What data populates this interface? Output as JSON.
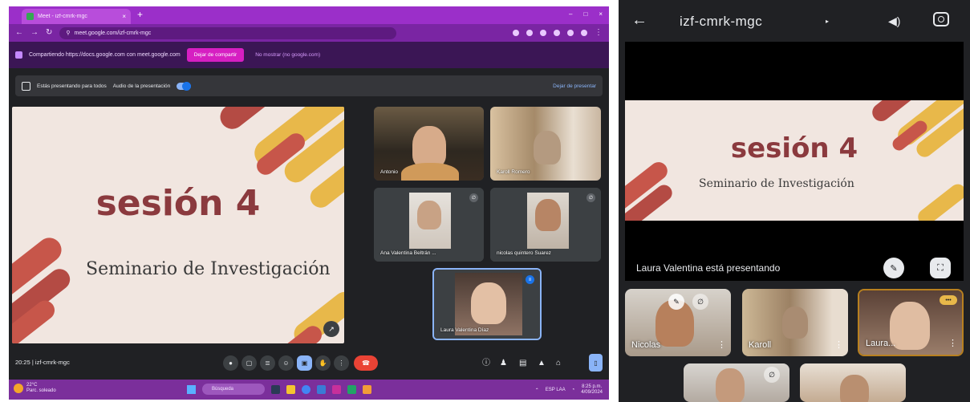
{
  "desktop": {
    "browser": {
      "tab_title": "Meet - izf-cmrk-mgc",
      "tab_close": "×",
      "new_tab": "+",
      "address": "meet.google.com/izf-cmrk-mgc",
      "window_controls": [
        "–",
        "□",
        "×"
      ]
    },
    "share_banner": {
      "text": "Compartiendo https://docs.google.com con meet.google.com",
      "stop_button": "Dejar de compartir",
      "hide_button": "No mostrar (no google.com)"
    },
    "presentation_bar": {
      "label": "Estás presentando para todos",
      "audio_label": "Audio de la presentación",
      "audio_on": true,
      "stop_label": "Dejar de presentar"
    },
    "slide": {
      "title": "sesión 4",
      "subtitle": "Seminario de Investigación",
      "background": "#f1e6e0",
      "title_color": "#8b3a3e",
      "accent_colors": [
        "#e8b84a",
        "#c7564a",
        "#b44b44"
      ]
    },
    "tiles": [
      {
        "name": "Antonio",
        "has_mic_badge": false
      },
      {
        "name": "Karoll Romero",
        "has_mic_badge": false
      },
      {
        "name": "Ana Valentina Beltrán ...",
        "has_mic_badge": true
      },
      {
        "name": "nicolas quintero Suarez",
        "has_mic_badge": true
      },
      {
        "name": "Laura Valentina Díaz",
        "has_mic_badge": true,
        "speaking": true
      }
    ],
    "meeting_bar": {
      "time": "20:25",
      "separator": "|",
      "code": "izf-cmrk-mgc"
    },
    "controls_icons": [
      "mic-icon",
      "camera-icon",
      "captions-icon",
      "emoji-icon",
      "present-icon",
      "hand-icon",
      "more-icon",
      "leave-call-icon"
    ],
    "right_controls_icons": [
      "info-icon",
      "people-icon",
      "chat-icon",
      "activities-icon",
      "lock-icon",
      "chat-panel-icon"
    ],
    "taskbar": {
      "weather_temp": "22°C",
      "weather_desc": "Parc. soleado",
      "search_placeholder": "Búsqueda",
      "tray_lang": "ESP LAA",
      "clock_time": "8:25 p.m.",
      "clock_date": "4/09/2024"
    }
  },
  "mobile": {
    "meeting_code": "izf-cmrk-mgc",
    "back_glyph": "←",
    "caret_glyph": "▸",
    "slide": {
      "title": "sesión 4",
      "subtitle": "Seminario de Investigación"
    },
    "presenter_text": "Laura Valentina está presentando",
    "tiles": [
      {
        "name": "Nicolas"
      },
      {
        "name": "Karoll"
      },
      {
        "name": "Laura..."
      },
      {
        "name": ""
      },
      {
        "name": ""
      }
    ],
    "menu_glyph": "⋮"
  },
  "theme": {
    "meet_dark": "#202124",
    "browser_purple": "#9b2fc9",
    "accent_blue": "#8ab4f8",
    "leave_red": "#ea4335"
  }
}
